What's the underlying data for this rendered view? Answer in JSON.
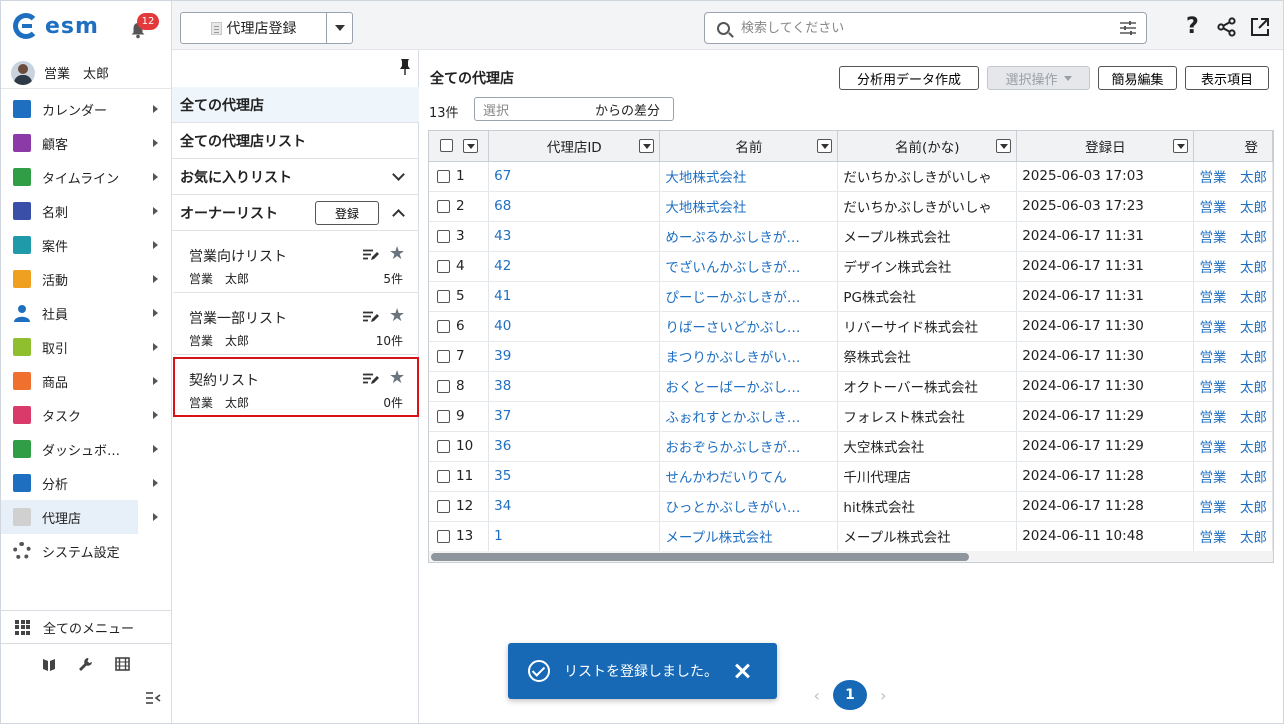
{
  "app": {
    "logo_text": "esm",
    "notification_count": "12"
  },
  "user": {
    "name": "営業　太郎"
  },
  "nav": {
    "items": [
      {
        "label": "カレンダー",
        "icon": "calendar-icon",
        "color": "#1f6fc1"
      },
      {
        "label": "顧客",
        "icon": "building-icon",
        "color": "#8b3aa8"
      },
      {
        "label": "タイムライン",
        "icon": "timeline-icon",
        "color": "#2f9e44"
      },
      {
        "label": "名刺",
        "icon": "business-card-icon",
        "color": "#3a4fa8"
      },
      {
        "label": "案件",
        "icon": "project-icon",
        "color": "#1e9aa8"
      },
      {
        "label": "活動",
        "icon": "activity-icon",
        "color": "#f0a020"
      },
      {
        "label": "社員",
        "icon": "employee-icon",
        "color": "#1f6fc1"
      },
      {
        "label": "取引",
        "icon": "deal-icon",
        "color": "#8fbf2f"
      },
      {
        "label": "商品",
        "icon": "product-icon",
        "color": "#f07030"
      },
      {
        "label": "タスク",
        "icon": "task-icon",
        "color": "#d93a6a"
      },
      {
        "label": "ダッシュボ…",
        "icon": "dashboard-icon",
        "color": "#2f9e44"
      },
      {
        "label": "分析",
        "icon": "analysis-icon",
        "color": "#1f6fc1"
      },
      {
        "label": "代理店",
        "icon": "agency-icon",
        "color": "#d0d0d0"
      },
      {
        "label": "システム設定",
        "icon": "gear-icon",
        "color": "#555555"
      }
    ],
    "all_menu_label": "全てのメニュー"
  },
  "toolbar": {
    "register_button_label": "代理店登録",
    "search_placeholder": "検索してください"
  },
  "list_panel": {
    "all_agencies": "全ての代理店",
    "all_agency_lists": "全ての代理店リスト",
    "favorites_section": "お気に入りリスト",
    "owner_section": "オーナーリスト",
    "register_label": "登録",
    "cards": [
      {
        "title": "営業向けリスト",
        "owner": "営業　太郎",
        "count": "5件"
      },
      {
        "title": "営業一部リスト",
        "owner": "営業　太郎",
        "count": "10件"
      },
      {
        "title": "契約リスト",
        "owner": "営業　太郎",
        "count": "0件"
      }
    ]
  },
  "main": {
    "title": "全ての代理店",
    "buttons": {
      "export": "分析用データ作成",
      "bulk": "選択操作",
      "quick_edit": "簡易編集",
      "columns": "表示項目"
    },
    "count": "13件",
    "diff_placeholder": "選択",
    "diff_suffix": "からの差分",
    "columns": [
      "代理店ID",
      "名前",
      "名前(かな)",
      "登録日",
      "登"
    ],
    "rows": [
      {
        "n": "1",
        "id": "67",
        "name": "大地株式会社",
        "kana": "だいちかぶしきがいしゃ",
        "date": "2025-06-03 17:03",
        "owner": "営業　太郎"
      },
      {
        "n": "2",
        "id": "68",
        "name": "大地株式会社",
        "kana": "だいちかぶしきがいしゃ",
        "date": "2025-06-03 17:23",
        "owner": "営業　太郎"
      },
      {
        "n": "3",
        "id": "43",
        "name": "めーぷるかぶしきが…",
        "kana": "メープル株式会社",
        "date": "2024-06-17 11:31",
        "owner": "営業　太郎"
      },
      {
        "n": "4",
        "id": "42",
        "name": "でざいんかぶしきが…",
        "kana": "デザイン株式会社",
        "date": "2024-06-17 11:31",
        "owner": "営業　太郎"
      },
      {
        "n": "5",
        "id": "41",
        "name": "ぴーじーかぶしきが…",
        "kana": "PG株式会社",
        "date": "2024-06-17 11:31",
        "owner": "営業　太郎"
      },
      {
        "n": "6",
        "id": "40",
        "name": "りばーさいどかぶし…",
        "kana": "リバーサイド株式会社",
        "date": "2024-06-17 11:30",
        "owner": "営業　太郎"
      },
      {
        "n": "7",
        "id": "39",
        "name": "まつりかぶしきがい…",
        "kana": "祭株式会社",
        "date": "2024-06-17 11:30",
        "owner": "営業　太郎"
      },
      {
        "n": "8",
        "id": "38",
        "name": "おくとーばーかぶし…",
        "kana": "オクトーバー株式会社",
        "date": "2024-06-17 11:30",
        "owner": "営業　太郎"
      },
      {
        "n": "9",
        "id": "37",
        "name": "ふぉれすとかぶしき…",
        "kana": "フォレスト株式会社",
        "date": "2024-06-17 11:29",
        "owner": "営業　太郎"
      },
      {
        "n": "10",
        "id": "36",
        "name": "おおぞらかぶしきが…",
        "kana": "大空株式会社",
        "date": "2024-06-17 11:29",
        "owner": "営業　太郎"
      },
      {
        "n": "11",
        "id": "35",
        "name": "せんかわだいりてん",
        "kana": "千川代理店",
        "date": "2024-06-17 11:28",
        "owner": "営業　太郎"
      },
      {
        "n": "12",
        "id": "34",
        "name": "ひっとかぶしきがい…",
        "kana": "hit株式会社",
        "date": "2024-06-17 11:28",
        "owner": "営業　太郎"
      },
      {
        "n": "13",
        "id": "1",
        "name": "メープル株式会社",
        "kana": "メープル株式会社",
        "date": "2024-06-11 10:48",
        "owner": "営業　太郎"
      }
    ]
  },
  "toast": {
    "message": "リストを登録しました。"
  },
  "pager": {
    "current": "1",
    "prev": "‹",
    "next": "›"
  }
}
